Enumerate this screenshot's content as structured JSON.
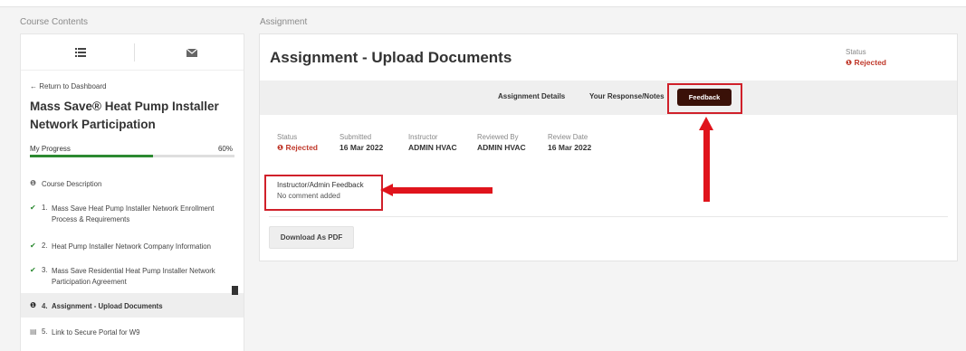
{
  "labels": {
    "course_contents": "Course Contents",
    "assignment": "Assignment"
  },
  "sidebar": {
    "list_icon": "list-icon",
    "mail_icon": "envelope-icon",
    "back": "← Return to Dashboard",
    "course_title": "Mass Save® Heat Pump Installer Network Participation",
    "progress_label": "My Progress",
    "progress_pct": "60%",
    "progress_value": 0.6,
    "items": [
      {
        "icon": "info-icon",
        "glyph": "❶",
        "number": "",
        "label": "Course Description"
      },
      {
        "icon": "check-icon",
        "glyph": "✔",
        "number": "1.",
        "label": "Mass Save Heat Pump Installer Network Enrollment Process & Requirements"
      },
      {
        "icon": "check-icon",
        "glyph": "✔",
        "number": "2.",
        "label": "Heat Pump Installer Network Company Information"
      },
      {
        "icon": "check-icon",
        "glyph": "✔",
        "number": "3.",
        "label": "Mass Save Residential Heat Pump Installer Network Participation Agreement"
      },
      {
        "icon": "alert-icon",
        "glyph": "❶",
        "number": "4.",
        "label": "Assignment - Upload Documents"
      },
      {
        "icon": "document-icon",
        "glyph": "▤",
        "number": "5.",
        "label": "Link to Secure Portal for W9"
      }
    ]
  },
  "card": {
    "title": "Assignment - Upload Documents",
    "status_label": "Status",
    "status_value": "❶ Rejected",
    "tabs": {
      "details": "Assignment Details",
      "response": "Your Response/Notes",
      "feedback": "Feedback"
    },
    "details": [
      {
        "label": "Status",
        "value": "❶ Rejected"
      },
      {
        "label": "Submitted",
        "value": "16 Mar 2022"
      },
      {
        "label": "Instructor",
        "value": "ADMIN HVAC"
      },
      {
        "label": "Reviewed By",
        "value": "ADMIN HVAC"
      },
      {
        "label": "Review Date",
        "value": "16 Mar 2022"
      }
    ],
    "feedback_heading": "Instructor/Admin Feedback",
    "feedback_body": "No comment added",
    "pdf_button": "Download As PDF"
  },
  "colors": {
    "accent_dark": "#3a1108",
    "rejected": "#c0392b",
    "annotation_red": "#e0141c",
    "progress": "#2c8a31"
  }
}
